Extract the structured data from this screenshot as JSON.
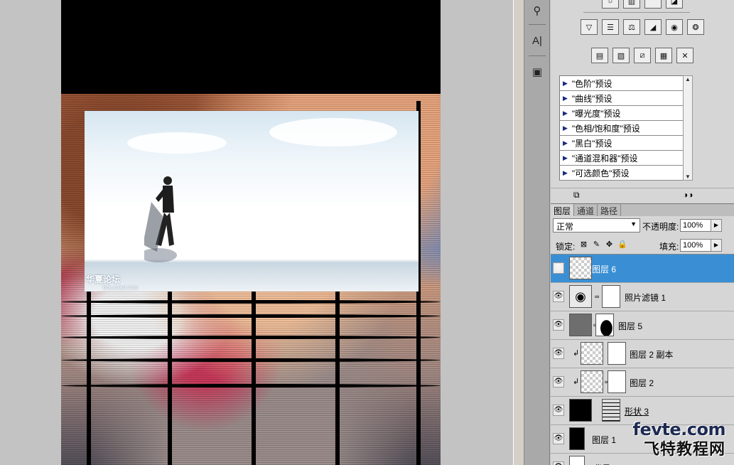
{
  "canvas": {
    "photo_watermark": "华夏论坛",
    "photo_watermark_url": "bbs.hxsd.com"
  },
  "toolbar": {
    "icons": [
      "usb-clone-icon",
      "type-tool-icon",
      "screen-mode-icon"
    ]
  },
  "adjustments": {
    "row1": [
      "levels-icon",
      "curves-icon",
      "balance-icon",
      "black-white-icon",
      "photo-filter-icon",
      "channel-mixer-icon"
    ],
    "row2": [
      "posterize-icon",
      "gradient-map-icon",
      "selective-color-icon",
      "gradient-icon",
      "threshold-icon"
    ],
    "presets": [
      "\"色阶\"预设",
      "\"曲线\"预设",
      "\"曝光度\"预设",
      "\"色相/饱和度\"预设",
      "\"黑白\"预设",
      "\"通道混和器\"预设",
      "\"可选颜色\"预设"
    ]
  },
  "layers_panel": {
    "tabs": [
      "图层",
      "通道",
      "路径"
    ],
    "blend_mode": "正常",
    "opacity_label": "不透明度:",
    "opacity_value": "100%",
    "lock_label": "锁定:",
    "fill_label": "填充:",
    "fill_value": "100%",
    "layers": [
      {
        "name": "图层 6",
        "selected": true
      },
      {
        "name": "照片滤镜 1",
        "selected": false
      },
      {
        "name": "图层 5",
        "selected": false
      },
      {
        "name": "图层 2 副本",
        "selected": false
      },
      {
        "name": "图层 2",
        "selected": false
      },
      {
        "name": "形状 3",
        "selected": false
      },
      {
        "name": "图层 1",
        "selected": false
      },
      {
        "name": "背景",
        "selected": false
      }
    ]
  },
  "site_watermark": {
    "en": "fevte.com",
    "cn": "飞特教程网"
  }
}
